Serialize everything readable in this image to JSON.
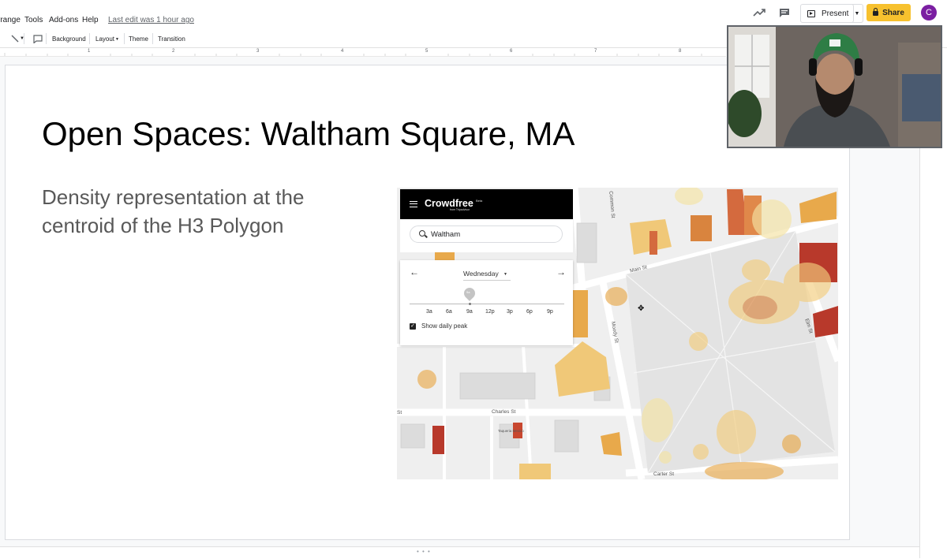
{
  "menubar": {
    "items": [
      "rrange",
      "Tools",
      "Add-ons",
      "Help"
    ],
    "last_edit": "Last edit was 1 hour ago",
    "present_label": "Present",
    "share_label": "Share",
    "avatar_letter": "C"
  },
  "toolbar": {
    "background_label": "Background",
    "layout_label": "Layout",
    "theme_label": "Theme",
    "transition_label": "Transition"
  },
  "ruler": {
    "numbers": [
      "1",
      "2",
      "3",
      "4",
      "5",
      "6",
      "7",
      "8"
    ]
  },
  "slide": {
    "title": "Open Spaces: Waltham Square, MA",
    "subtitle": "Density representation at the centroid of the H3 Polygon"
  },
  "crowdfree": {
    "logo": "Crowdfree",
    "beta": "Beta",
    "tagline": "from Tripadvisor",
    "search_value": "Waltham",
    "day": "Wednesday",
    "slider_marker": "9a",
    "ticks": [
      "3a",
      "6a",
      "9a",
      "12p",
      "3p",
      "6p",
      "9p"
    ],
    "show_daily_peak": "Show daily peak",
    "show_daily_peak_checked": true
  },
  "map": {
    "streets": {
      "main": "Main St",
      "common": "Common St",
      "moody": "Moody St",
      "elm": "Elm St",
      "charles": "Charles St",
      "carter": "Carter St",
      "st_left": "St",
      "taqueria": "Taqueria Mexico"
    }
  },
  "colors": {
    "share_yellow": "#f7c12e",
    "avatar_purple": "#7b1fa2",
    "heat_orange": "#e8a94b",
    "heat_red": "#b8392b"
  }
}
